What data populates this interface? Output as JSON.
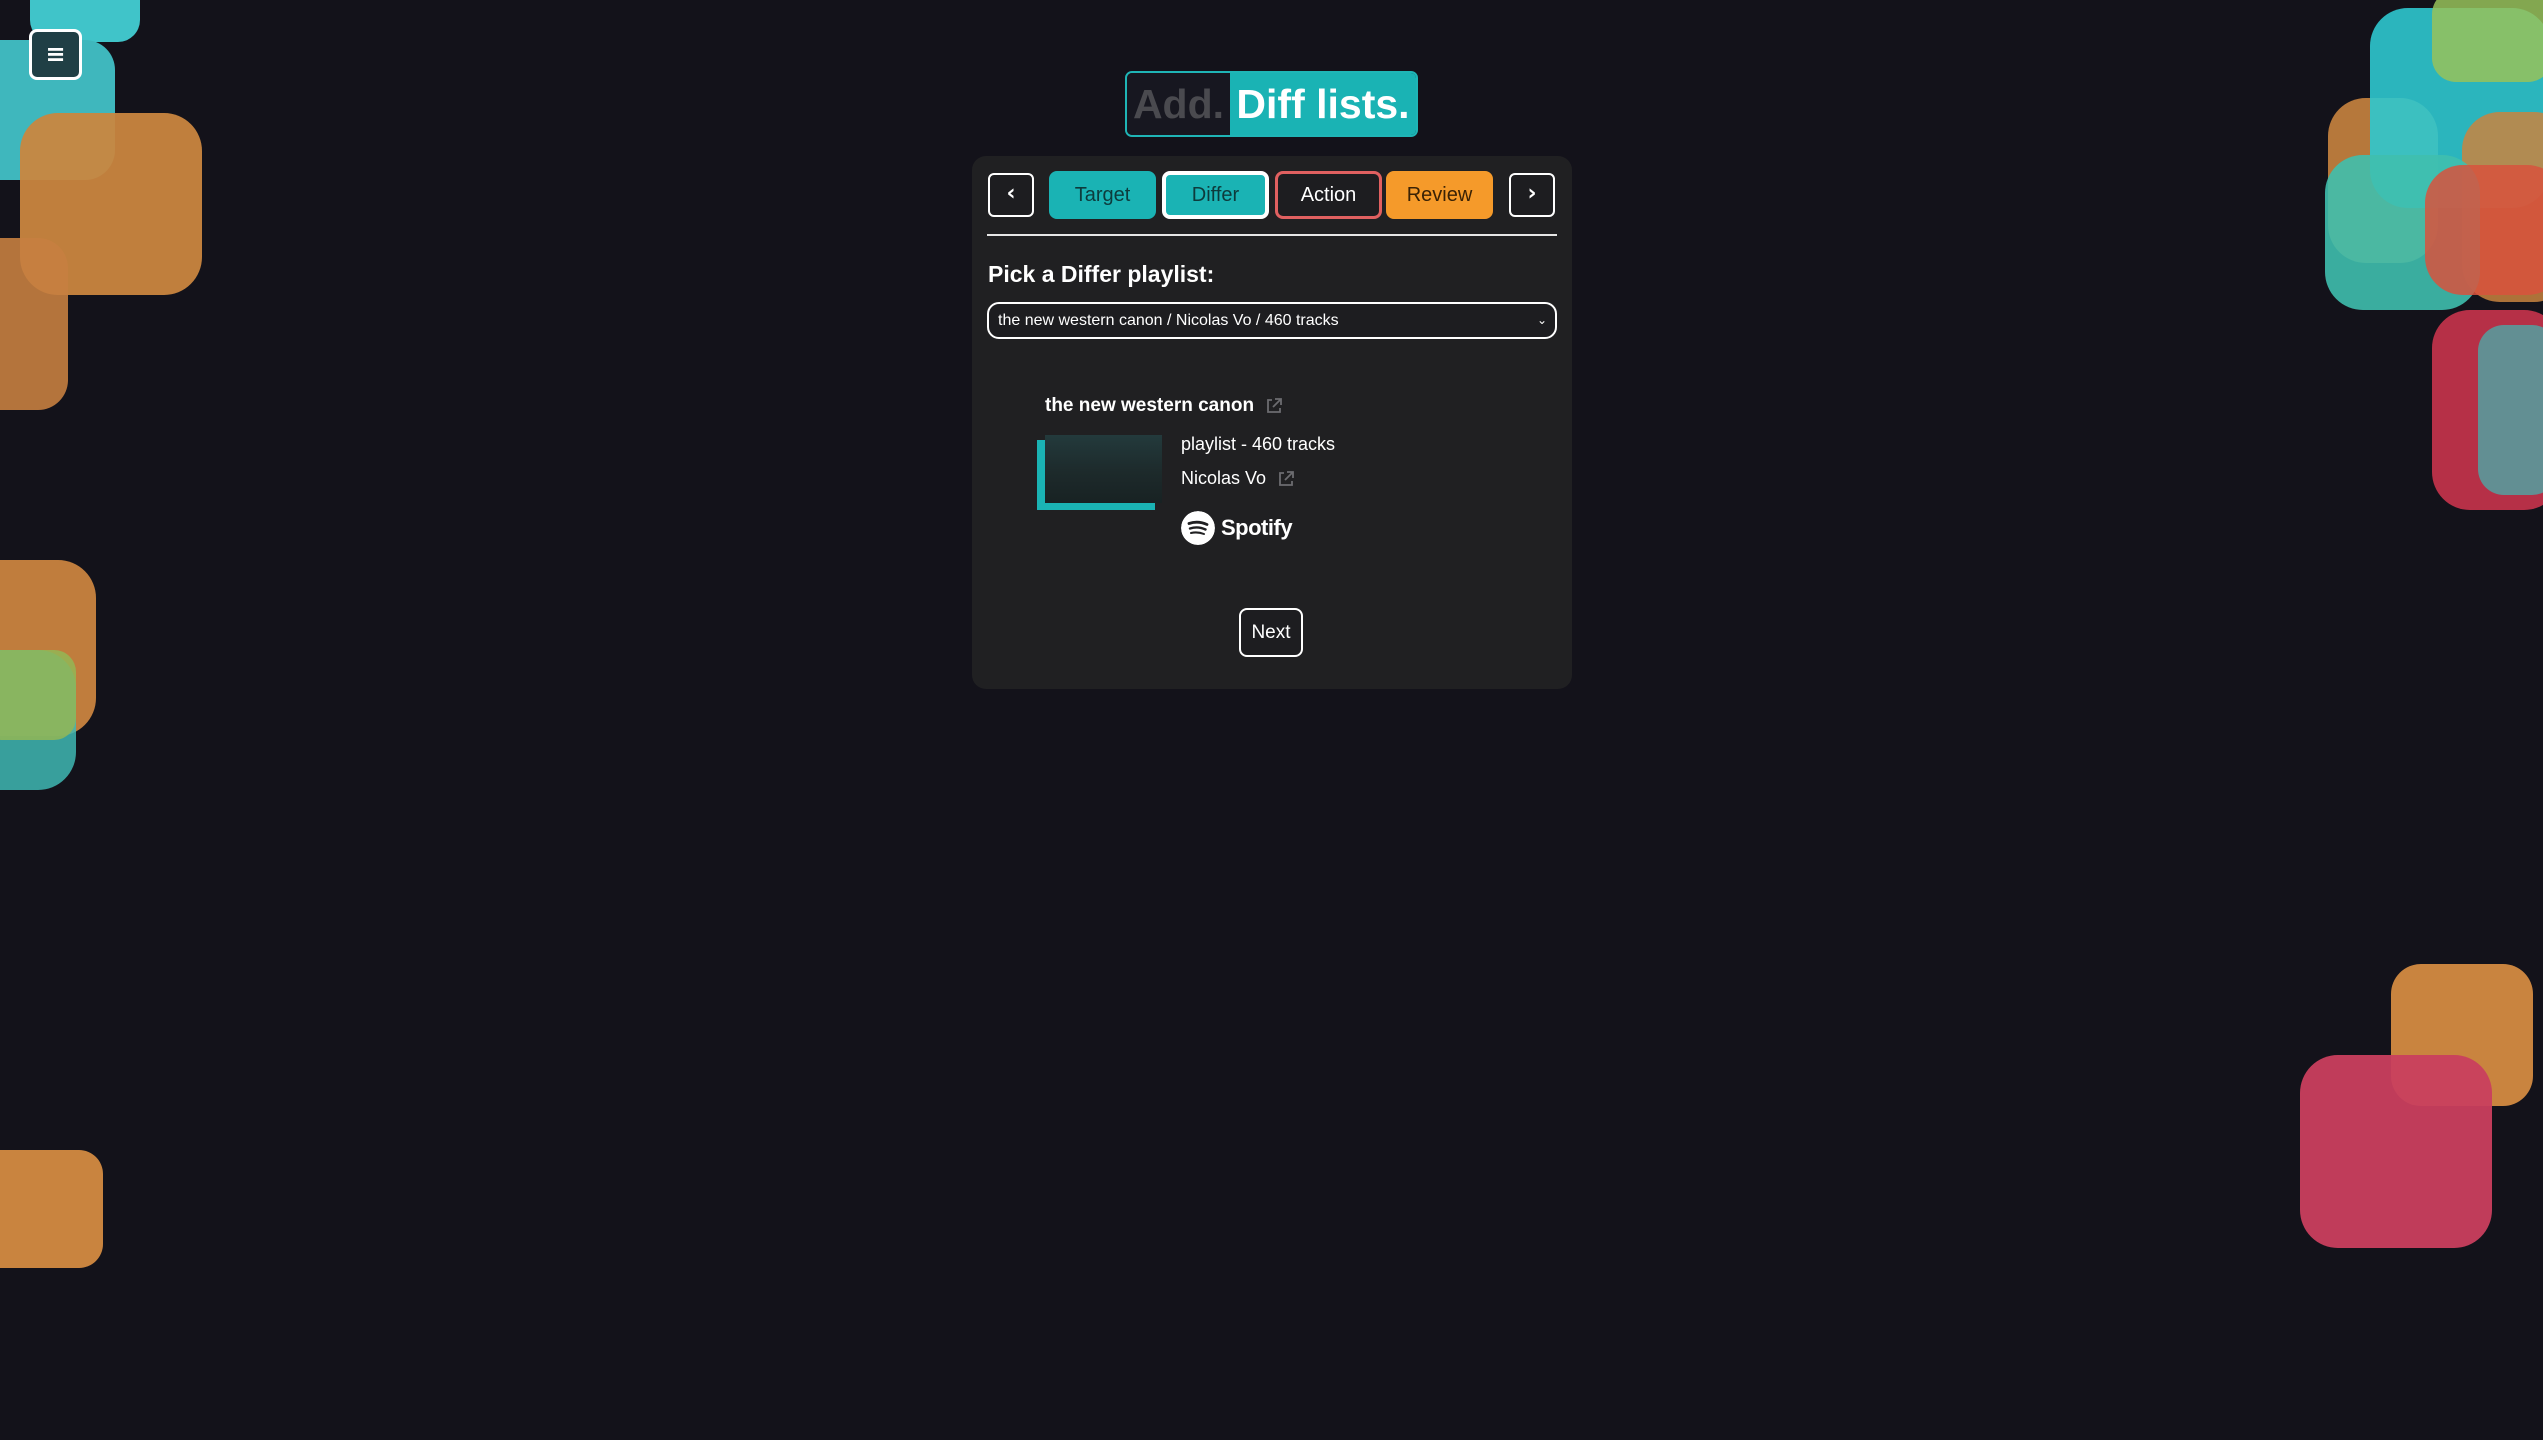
{
  "menu": {
    "icon": "≡"
  },
  "logo": {
    "add": "Add.",
    "diff": "Diff lists."
  },
  "nav": {
    "prev_icon": "‹",
    "next_icon": "›",
    "steps": [
      {
        "label": "Target"
      },
      {
        "label": "Differ"
      },
      {
        "label": "Action"
      },
      {
        "label": "Review"
      }
    ]
  },
  "picker": {
    "label": "Pick a Differ playlist:",
    "selected": "the new western canon / Nicolas Vo / 460 tracks",
    "chevron": "⌄"
  },
  "playlist": {
    "title": "the new western canon",
    "type_count": "playlist - 460 tracks",
    "owner": "Nicolas Vo",
    "service": "Spotify"
  },
  "actions": {
    "next": "Next"
  },
  "colors": {
    "teal": "#1ab3b4",
    "orange": "#f59a2a",
    "red_outline": "#e06060",
    "background": "#13121a",
    "card": "#202022"
  }
}
